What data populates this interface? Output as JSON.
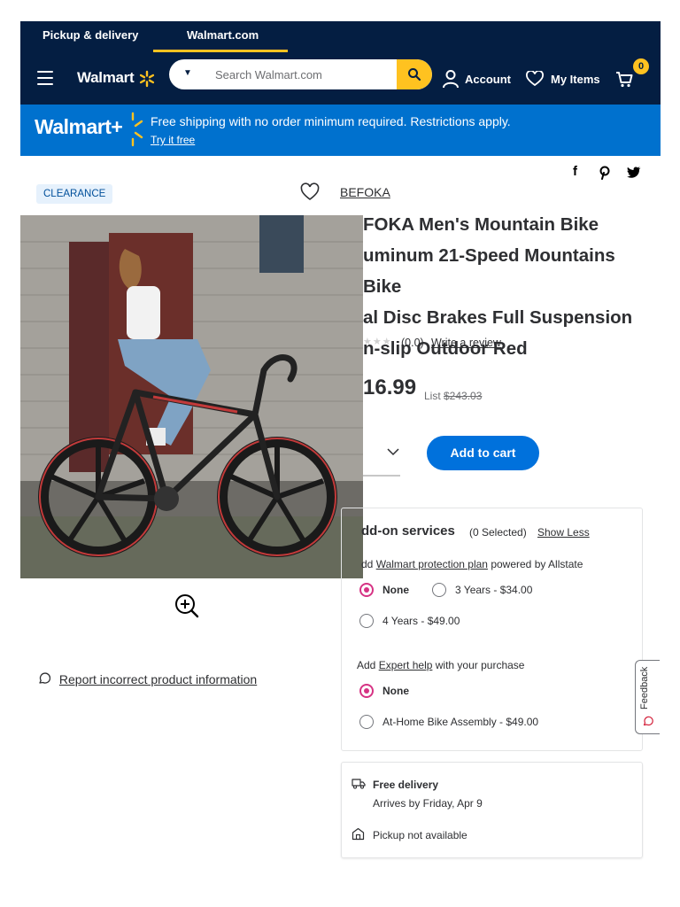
{
  "top_tabs": {
    "pickup": "Pickup & delivery",
    "walmart_com": "Walmart.com"
  },
  "header": {
    "logo": "Walmart",
    "search_placeholder": "Search Walmart.com",
    "account": "Account",
    "my_items": "My Items",
    "cart_count": "0"
  },
  "promo": {
    "logo": "Walmart+",
    "text": "Free shipping with no order minimum required. Restrictions apply.",
    "link": "Try it free"
  },
  "product": {
    "badge": "CLEARANCE",
    "brand": "BEFOKA",
    "title_lines": [
      "FOKA Men's Mountain Bike",
      "uminum 21-Speed Mountains Bike",
      "al Disc Brakes Full Suspension",
      "n-slip Outdoor Red"
    ],
    "rating": "(0.0)",
    "write_review": "Write a review",
    "price": "16.99",
    "list_label": "List",
    "list_price": "$243.03",
    "add_to_cart": "Add to cart",
    "report": "Report incorrect product information"
  },
  "services": {
    "title": "dd-on services",
    "selected": "(0 Selected)",
    "show_less": "Show Less",
    "protection_prefix": "dd",
    "protection_link": "Walmart protection plan",
    "protection_suffix": "powered by Allstate",
    "protection_options": [
      "None",
      "3 Years - $34.00",
      "4 Years - $49.00"
    ],
    "expert_prefix": "Add",
    "expert_link": "Expert help",
    "expert_suffix": "with your purchase",
    "expert_options": [
      "None",
      "At-Home Bike Assembly - $49.00"
    ]
  },
  "delivery": {
    "title": "Free delivery",
    "arrives": "Arrives by Friday, Apr 9",
    "pickup": "Pickup not available"
  },
  "feedback": "Feedback",
  "colors": {
    "navy": "#041e42",
    "blue": "#0071ce",
    "yellow": "#ffc220",
    "button_blue": "#0071dc",
    "radio_pink": "#d63384"
  }
}
